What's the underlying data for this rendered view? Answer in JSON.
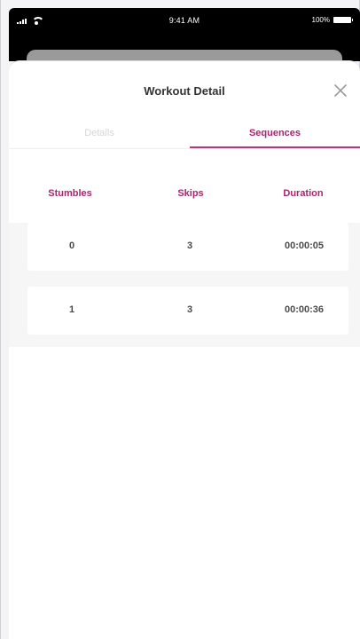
{
  "status_bar": {
    "time": "9:41 AM",
    "battery": "100%"
  },
  "sheet": {
    "title": "Workout Detail",
    "tabs": [
      {
        "label": "Details",
        "active": false
      },
      {
        "label": "Sequences",
        "active": true
      }
    ]
  },
  "table": {
    "headers": [
      "Stumbles",
      "Skips",
      "Duration"
    ],
    "rows": [
      {
        "stumbles": "0",
        "skips": "3",
        "duration": "00:00:05"
      },
      {
        "stumbles": "1",
        "skips": "3",
        "duration": "00:00:36"
      }
    ]
  },
  "colors": {
    "accent": "#c72f78",
    "accent_text": "#b1226c",
    "inactive_tab": "#d6d6da"
  },
  "icons": {
    "close": "close-icon"
  }
}
